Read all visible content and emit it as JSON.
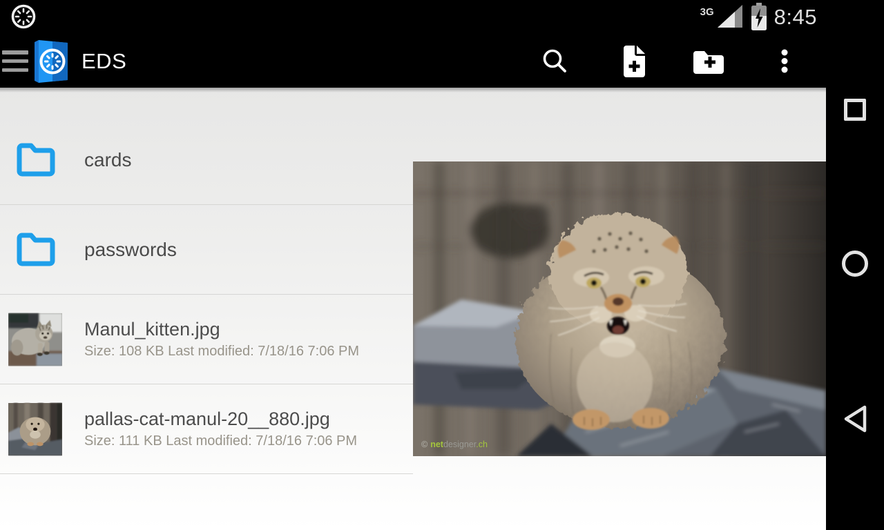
{
  "status_bar": {
    "time": "8:45",
    "network": "3G"
  },
  "toolbar": {
    "title": "EDS"
  },
  "icons": {
    "status": [
      "clock-icon",
      "signal-icon",
      "battery-charging-icon"
    ],
    "toolbar": [
      "menu-icon",
      "search-icon",
      "new-file-icon",
      "new-folder-icon",
      "overflow-icon"
    ],
    "list": [
      "folder-icon"
    ],
    "nav": [
      "recents-icon",
      "home-icon",
      "back-icon"
    ]
  },
  "file_list": {
    "items": [
      {
        "type": "folder",
        "name": "cards"
      },
      {
        "type": "folder",
        "name": "passwords"
      },
      {
        "type": "file",
        "name": "Manul_kitten.jpg",
        "details": "Size: 108 KB Last modified: 7/18/16 7:06 PM"
      },
      {
        "type": "file",
        "name": "pallas-cat-manul-20__880.jpg",
        "details": "Size: 111 KB Last modified: 7/18/16 7:06 PM"
      }
    ]
  },
  "preview": {
    "subject": "Pallas's cat (manul) standing on rocks",
    "watermark": {
      "copyright": "©",
      "net": "net",
      "designer": "designer",
      "tld": ".ch"
    }
  },
  "colors": {
    "accent_blue": "#1E9FEA",
    "app_icon_blue": "#1E88E5",
    "watermark_green": "#A4C63C",
    "bar_black": "#000000"
  }
}
